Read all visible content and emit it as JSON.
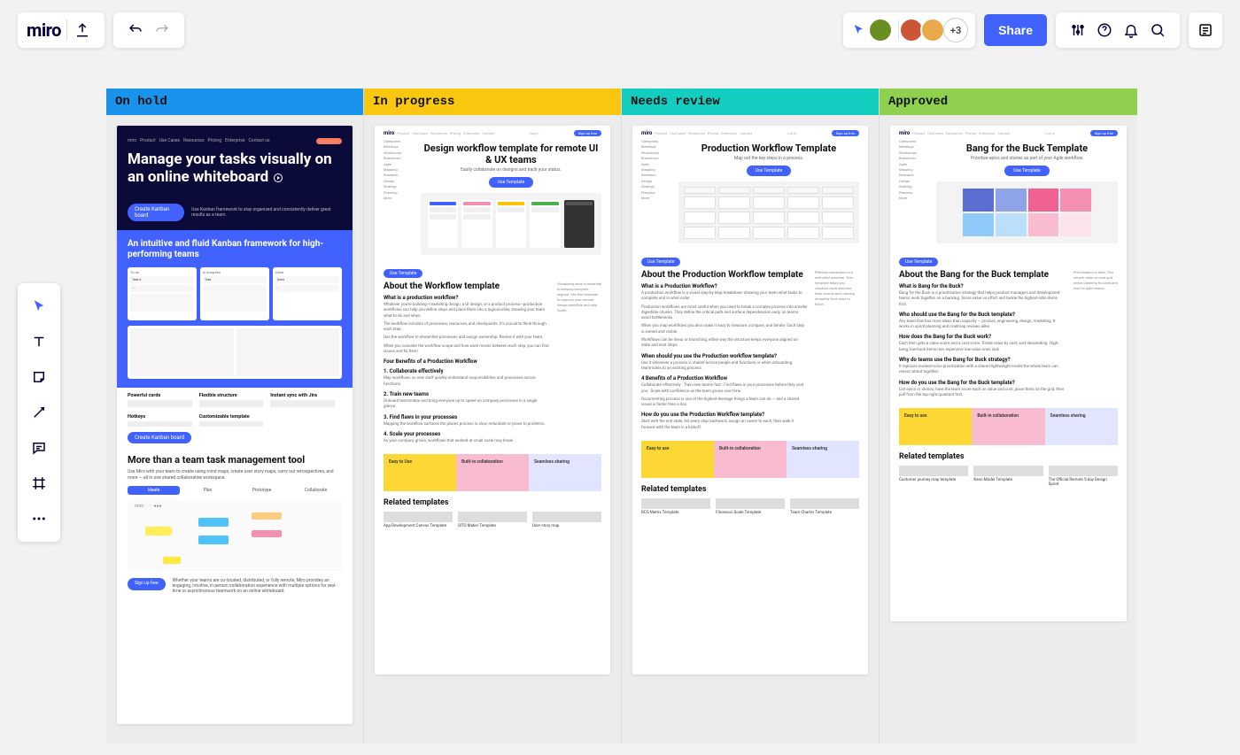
{
  "app": {
    "logo": "miro"
  },
  "topbar": {
    "share_label": "Share",
    "avatar_overflow": "+3",
    "avatars": [
      "#6b8e23",
      "#cc5533",
      "#e8a94b"
    ]
  },
  "toolbar": {
    "items": [
      "select",
      "text",
      "sticky-note",
      "line",
      "comment",
      "frame",
      "more"
    ]
  },
  "columns": [
    {
      "title": "On hold",
      "color": "#1a93ec"
    },
    {
      "title": "In progress",
      "color": "#fac710"
    },
    {
      "title": "Needs review",
      "color": "#14cdc1"
    },
    {
      "title": "Approved",
      "color": "#8fd14f"
    }
  ],
  "card0": {
    "hero_title": "Manage your tasks visually on an online whiteboard",
    "hero_cta": "Create Kanban board",
    "hero_sub": "Use Kanban framework to stay organized and consistently deliver great results as a team.",
    "blue_heading": "An intuitive and fluid Kanban framework for high-performing teams",
    "kcols": [
      "To do",
      "In progress",
      "Done"
    ],
    "features": [
      "Powerful cards",
      "Flexible structure",
      "Instant sync with Jira",
      "Hotkeys",
      "Customizable template"
    ],
    "section2_title": "More than a team task management tool",
    "section2_sub": "Use Miro with your team to create using mind maps, create user story maps, carry out retrospectives, and more — all in one shared collaborative workspace.",
    "tabs": [
      "Ideate",
      "Plan",
      "Prototype",
      "Collaborate"
    ],
    "signup": "Sign up free",
    "footer_para": "Whether your teams are co-located, distributed, or fully remote, Miro provides an engaging, intuitive, in-person collaboration experience with multiple options for real-time or asynchronous teamwork on an online whiteboard."
  },
  "card1": {
    "title": "Design workflow template for remote UI & UX teams",
    "sub": "Easily collaborate on designs and track your status.",
    "use": "Use Template",
    "about_title": "About the Workflow template",
    "q1": "What is a production workflow?",
    "benefits_title": "Four Benefits of a Production Workflow",
    "b1": "1. Collaborate effectively",
    "b2": "2. Train new teams",
    "b3": "3. Find flaws in your processes",
    "b4": "4. Scale your processes",
    "tiles": [
      "Easy to Use",
      "Built-in collaboration",
      "Seamless sharing"
    ],
    "related_title": "Related templates",
    "related": [
      "App Development Canvas Template",
      "SITO Maker Template",
      "User story map"
    ]
  },
  "card2": {
    "title": "Production Workflow Template",
    "sub": "Map out the key steps in a process.",
    "use": "Use Template",
    "about_title": "About the Production Workflow template",
    "q1": "What is a Production Workflow?",
    "q2": "When should you use the Production workflow template?",
    "q3": "4 Benefits of a Production Workflow",
    "q4": "How do you use the Production Workflow template?",
    "tiles": [
      "Easy to use",
      "Built-in collaboration",
      "Seamless sharing"
    ],
    "related_title": "Related templates",
    "related": [
      "BCG Matrix Template",
      "Fibonacci Scale Template",
      "Team Charter Template"
    ]
  },
  "card3": {
    "title": "Bang for the Buck Template",
    "sub": "Prioritize epics and stories as part of your Agile workflow.",
    "use": "Use Template",
    "about_title": "About the Bang for the Buck template",
    "q1": "What is Bang for the Buck?",
    "q2": "Who should use the Bang for the Buck template?",
    "q3": "How does the Bang for the Buck work?",
    "q4": "Why do teams use the Bang for Buck strategy?",
    "q5": "How do you use the Bang for the Buck template?",
    "tiles": [
      "Easy to use",
      "Built-in collaboration",
      "Seamless sharing"
    ],
    "related_title": "Related templates",
    "related": [
      "Customer journey map template",
      "Kano Model Template",
      "The Official Remote 5-day Design Sprint"
    ]
  }
}
